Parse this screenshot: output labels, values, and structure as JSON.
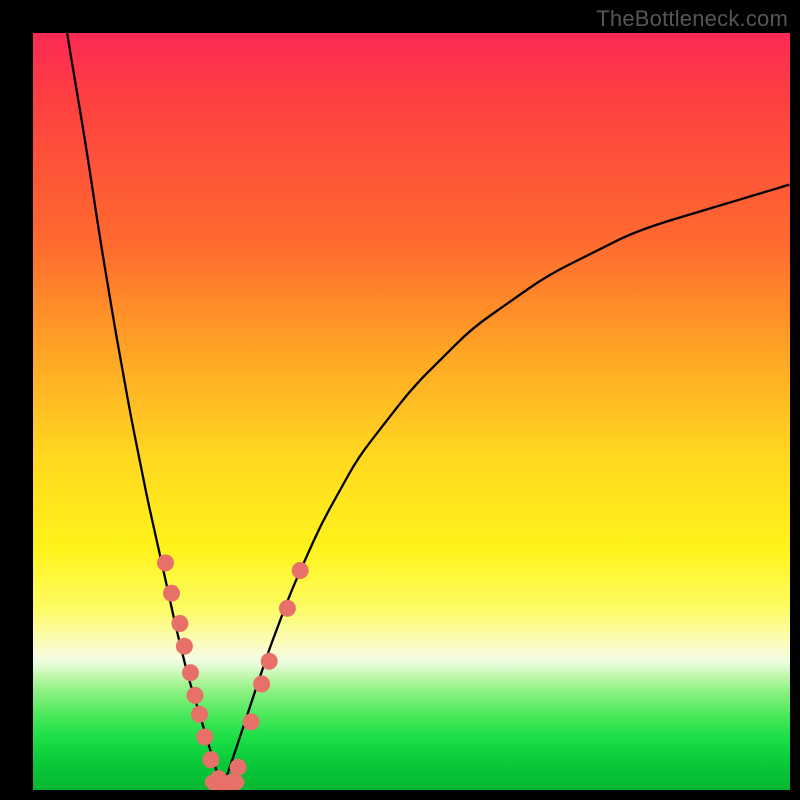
{
  "watermark": "TheBottleneck.com",
  "colors": {
    "marker": "#e77169",
    "curve": "#000000",
    "background_top": "#fd2a55",
    "background_bottom": "#06b631"
  },
  "chart_data": {
    "type": "line",
    "title": "",
    "xlabel": "",
    "ylabel": "",
    "xlim": [
      0,
      100
    ],
    "ylim": [
      0,
      100
    ],
    "note": "Bottleneck-style V curve. x is a normalized component ratio; y is bottleneck percentage (0 = balanced at the dip). Values below are estimated from pixel positions.",
    "series": [
      {
        "name": "left-branch",
        "x": [
          4.5,
          7,
          9,
          11,
          13,
          15,
          17,
          19,
          20.5,
          22,
          23.5,
          25
        ],
        "y": [
          100,
          85,
          72,
          60,
          49,
          39,
          30,
          21,
          15,
          10,
          5,
          0
        ]
      },
      {
        "name": "right-branch",
        "x": [
          25,
          27,
          29,
          31,
          34,
          38,
          43,
          50,
          58,
          68,
          80,
          100
        ],
        "y": [
          0,
          6,
          12,
          18,
          26,
          35,
          44,
          53,
          61,
          68,
          74,
          80
        ]
      }
    ],
    "markers": {
      "name": "highlighted-points",
      "comment": "Pink dots clustered near the dip along both branches.",
      "points": [
        {
          "x": 17.5,
          "y": 30
        },
        {
          "x": 18.3,
          "y": 26
        },
        {
          "x": 19.4,
          "y": 22
        },
        {
          "x": 20.0,
          "y": 19
        },
        {
          "x": 20.8,
          "y": 15.5
        },
        {
          "x": 21.4,
          "y": 12.5
        },
        {
          "x": 22.0,
          "y": 10
        },
        {
          "x": 22.7,
          "y": 7
        },
        {
          "x": 23.5,
          "y": 4
        },
        {
          "x": 24.5,
          "y": 1.5
        },
        {
          "x": 25.4,
          "y": 0.5
        },
        {
          "x": 26.2,
          "y": 1
        },
        {
          "x": 27.1,
          "y": 3
        },
        {
          "x": 28.8,
          "y": 9
        },
        {
          "x": 30.2,
          "y": 14
        },
        {
          "x": 31.2,
          "y": 17
        },
        {
          "x": 33.6,
          "y": 24
        },
        {
          "x": 35.3,
          "y": 29
        }
      ]
    }
  }
}
